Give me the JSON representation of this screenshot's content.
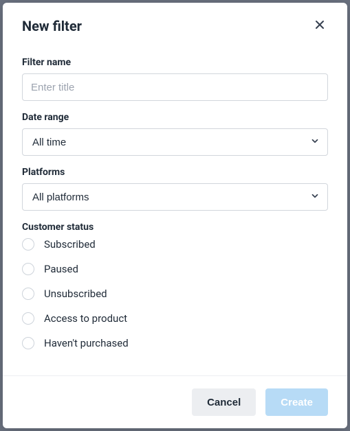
{
  "modal": {
    "title": "New filter"
  },
  "filterName": {
    "label": "Filter name",
    "placeholder": "Enter title",
    "value": ""
  },
  "dateRange": {
    "label": "Date range",
    "selected": "All time"
  },
  "platforms": {
    "label": "Platforms",
    "selected": "All platforms"
  },
  "customerStatus": {
    "label": "Customer status",
    "options": [
      {
        "label": "Subscribed"
      },
      {
        "label": "Paused"
      },
      {
        "label": "Unsubscribed"
      },
      {
        "label": "Access to product"
      },
      {
        "label": "Haven't purchased"
      }
    ]
  },
  "footer": {
    "cancel": "Cancel",
    "create": "Create"
  }
}
